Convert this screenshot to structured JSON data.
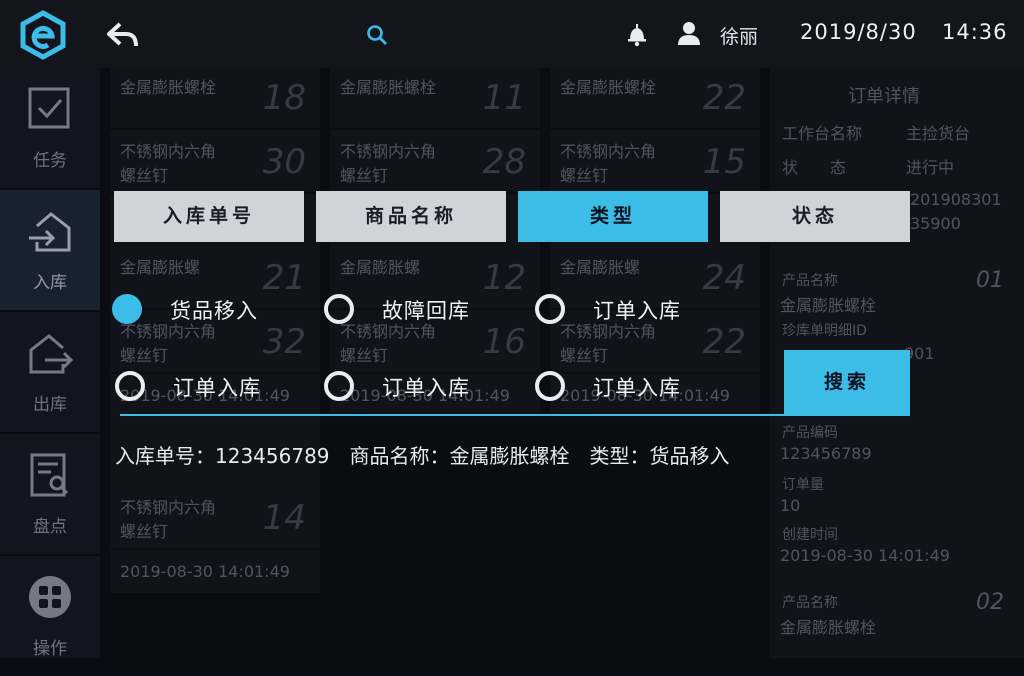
{
  "topbar": {
    "username": "徐丽",
    "date": "2019/8/30",
    "time": "14:36"
  },
  "sidebar": {
    "items": [
      {
        "label": "任务",
        "icon": "check-square-icon"
      },
      {
        "label": "入库",
        "icon": "login-house-icon"
      },
      {
        "label": "出库",
        "icon": "logout-house-icon"
      },
      {
        "label": "盘点",
        "icon": "inventory-doc-icon"
      },
      {
        "label": "操作",
        "icon": "grid-menu-icon"
      }
    ]
  },
  "background": {
    "col1": [
      {
        "title": "金属膨胀螺栓",
        "num": "18"
      },
      {
        "title": "不锈钢内六角螺丝钉",
        "num": "30"
      },
      {
        "title": "金属膨胀螺",
        "num": "21"
      },
      {
        "title": "不锈钢内六角螺丝钉",
        "num": "32"
      },
      {
        "title": "2019-08-30 14:01:49",
        "num": ""
      },
      {
        "title": "不锈钢内六角螺丝钉",
        "num": "14"
      },
      {
        "title": "2019-08-30  14:01:49",
        "num": ""
      }
    ],
    "col2": [
      {
        "title": "金属膨胀螺栓",
        "num": "11"
      },
      {
        "title": "不锈钢内六角螺丝钉",
        "num": "28"
      },
      {
        "title": "金属膨胀螺",
        "num": "12"
      },
      {
        "title": "不锈钢内六角螺丝钉",
        "num": "16"
      },
      {
        "title": "2019-08-30 14:01:49",
        "num": ""
      }
    ],
    "col3": [
      {
        "title": "金属膨胀螺栓",
        "num": "22"
      },
      {
        "title": "不锈钢内六角螺丝钉",
        "num": "15"
      },
      {
        "title": "金属膨胀螺",
        "num": "24"
      },
      {
        "title": "不锈钢内六角螺丝钉",
        "num": "22"
      },
      {
        "title": "2019-08-30 14:01:49",
        "num": ""
      }
    ],
    "detail": {
      "title": "订单详情",
      "workbench_label": "工作台名称",
      "workbench_value": "主捡货台",
      "status_label": "状　　态",
      "status_value": "进行中",
      "order_no": "201908301",
      "order_no2": "35900",
      "item1_no": "01",
      "product_label": "产品名称",
      "product_value": "金属膨胀螺栓",
      "detail_id_label": "珍库单明细ID",
      "detail_id_value": "901",
      "code_label": "产品编码",
      "code_value": "123456789",
      "qty_label": "订单量",
      "qty_value": "10",
      "created_label": "创建时间",
      "created_value": "2019-08-30  14:01:49",
      "item2_no": "02",
      "product2_label": "产品名称",
      "product2_value": "金属膨胀螺栓"
    }
  },
  "filter": {
    "tabs": [
      "入库单号",
      "商品名称",
      "类型",
      "状态"
    ],
    "active_tab": 2,
    "options": [
      "货品移入",
      "故障回库",
      "订单入库",
      "订单入库",
      "订单入库",
      "订单入库"
    ],
    "selected_option": 0,
    "search_label": "搜索"
  },
  "summary": {
    "order_no": "入库单号：123456789",
    "product_name": "商品名称：金属膨胀螺栓",
    "type": "类型：货品移入"
  },
  "colors": {
    "accent": "#3bbde8",
    "background": "#0b0c13"
  }
}
